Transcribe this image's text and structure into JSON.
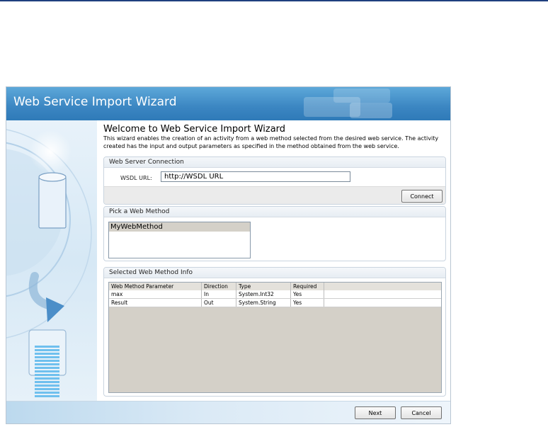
{
  "wizard": {
    "title": "Web Service Import Wizard",
    "welcome_title": "Welcome to Web Service Import Wizard",
    "welcome_desc": "This wizard enables the creation of an activity from a web method selected from the desired web service.  The activity created has the input and output parameters as specified in the method obtained from the web service."
  },
  "connection": {
    "group_title": "Web Server Connection",
    "wsdl_label": "WSDL URL:",
    "wsdl_value": "http://WSDL URL",
    "connect_label": "Connect"
  },
  "methods": {
    "group_title": "Pick a Web Method",
    "items": [
      "MyWebMethod"
    ]
  },
  "info": {
    "group_title": "Selected Web Method Info",
    "columns": [
      "Web Method Parameter",
      "Direction",
      "Type",
      "Required",
      ""
    ],
    "rows": [
      [
        "max",
        "In",
        "System.Int32",
        "Yes",
        ""
      ],
      [
        "Result",
        "Out",
        "System.String",
        "Yes",
        ""
      ]
    ]
  },
  "footer": {
    "next_label": "Next",
    "cancel_label": "Cancel"
  },
  "colors": {
    "header_blue": "#3b86c2",
    "accent_dark": "#1f3f7f"
  }
}
